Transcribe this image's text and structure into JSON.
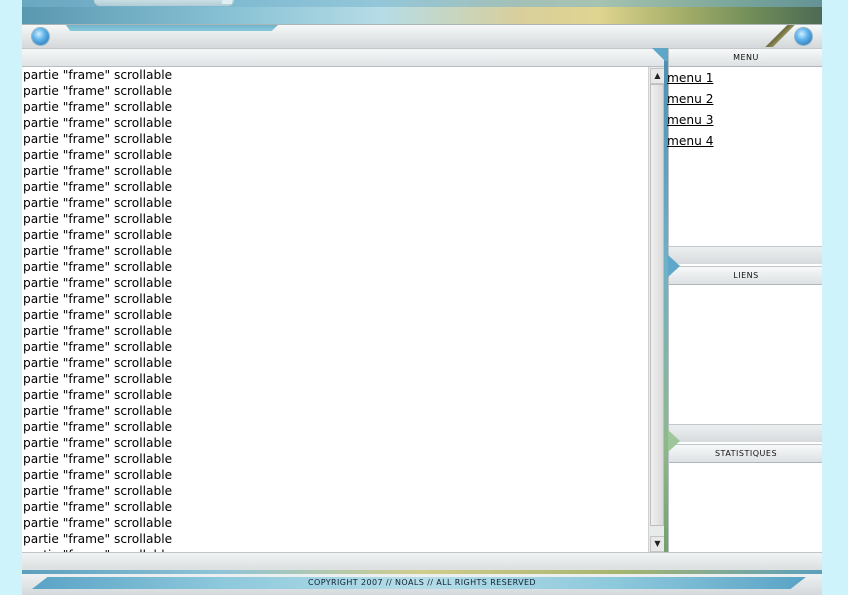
{
  "content": {
    "lines": [
      "partie \"frame\" scrollable",
      "partie \"frame\" scrollable",
      "partie \"frame\" scrollable",
      "partie \"frame\" scrollable",
      "partie \"frame\" scrollable",
      "partie \"frame\" scrollable",
      "partie \"frame\" scrollable",
      "partie \"frame\" scrollable",
      "partie \"frame\" scrollable",
      "partie \"frame\" scrollable",
      "partie \"frame\" scrollable",
      "partie \"frame\" scrollable",
      "partie \"frame\" scrollable",
      "partie \"frame\" scrollable",
      "partie \"frame\" scrollable",
      "partie \"frame\" scrollable",
      "partie \"frame\" scrollable",
      "partie \"frame\" scrollable",
      "partie \"frame\" scrollable",
      "partie \"frame\" scrollable",
      "partie \"frame\" scrollable",
      "partie \"frame\" scrollable",
      "partie \"frame\" scrollable",
      "partie \"frame\" scrollable",
      "partie \"frame\" scrollable",
      "partie \"frame\" scrollable",
      "partie \"frame\" scrollable",
      "partie \"frame\" scrollable",
      "partie \"frame\" scrollable",
      "partie \"frame\" scrollable",
      "partie \"frame\" scrollable"
    ],
    "scroll_up_icon": "triangle-up",
    "scroll_down_icon": "triangle-down"
  },
  "sidebar": {
    "menu_title": "MENU",
    "menu_items": [
      {
        "label": "menu 1"
      },
      {
        "label": "menu 2"
      },
      {
        "label": "menu 3"
      },
      {
        "label": "menu 4"
      }
    ],
    "links_title": "LIENS",
    "stats_title": "STATISTIQUES"
  },
  "footer": {
    "copyright": "COPYRIGHT 2007 // NOALS // ALL RIGHTS RESERVED"
  },
  "colors": {
    "page_background": "#cff3fb",
    "accent_blue": "#5ea7c8",
    "orb_blue": "#1f68a8"
  }
}
